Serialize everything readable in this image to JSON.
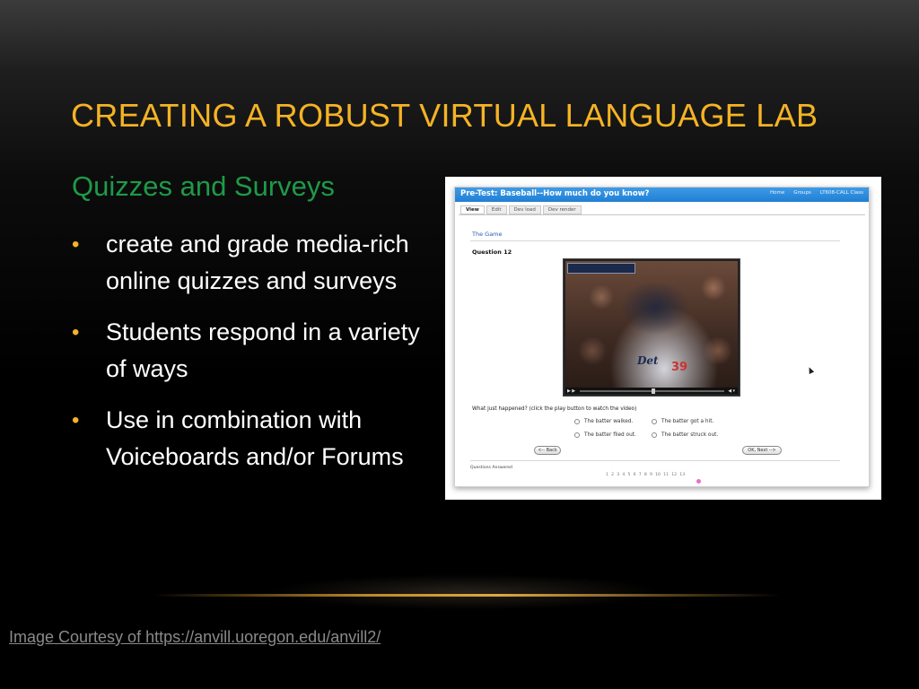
{
  "slide": {
    "title": "CREATING A ROBUST VIRTUAL LANGUAGE LAB",
    "subtitle": "Quizzes and Surveys",
    "bullet_symbol": "•",
    "bullets": [
      "create and grade media-rich online quizzes and surveys",
      "Students respond in a variety of ways",
      "Use in combination with Voiceboards and/or Forums"
    ],
    "credit_link": "Image Courtesy of https://anvill.uoregon.edu/anvill2/"
  },
  "colors": {
    "title": "#f5b324",
    "subtitle": "#1e9a48",
    "bullet_text": "#ffffff",
    "credit": "#8a8a8a",
    "app_header": "#1f7fd4"
  },
  "screenshot": {
    "app_title": "Pre-Test: Baseball--How much do you know?",
    "nav": [
      "Home",
      "Groups",
      "LT608-CALL Class"
    ],
    "tabs": [
      "View",
      "Edit",
      "Dev load",
      "Dev render"
    ],
    "active_tab": "View",
    "section_link": "The Game",
    "question_title": "Question 12",
    "video": {
      "jersey_script": "Det",
      "jersey_number": "39",
      "play_icon": "play-icon",
      "volume_icon": "volume-icon"
    },
    "prompt": "What just happened? (click the play button to watch the video)",
    "options": [
      "The batter walked.",
      "The batter got a hit.",
      "The batter flied out.",
      "The batter struck out."
    ],
    "back_button": "<-- Back",
    "next_button": "OK, Next -->",
    "answered_label": "Questions Answered",
    "pages": [
      "1",
      "2",
      "3",
      "4",
      "5",
      "6",
      "7",
      "8",
      "9",
      "10",
      "11",
      "12",
      "13"
    ],
    "current_page": "12"
  }
}
